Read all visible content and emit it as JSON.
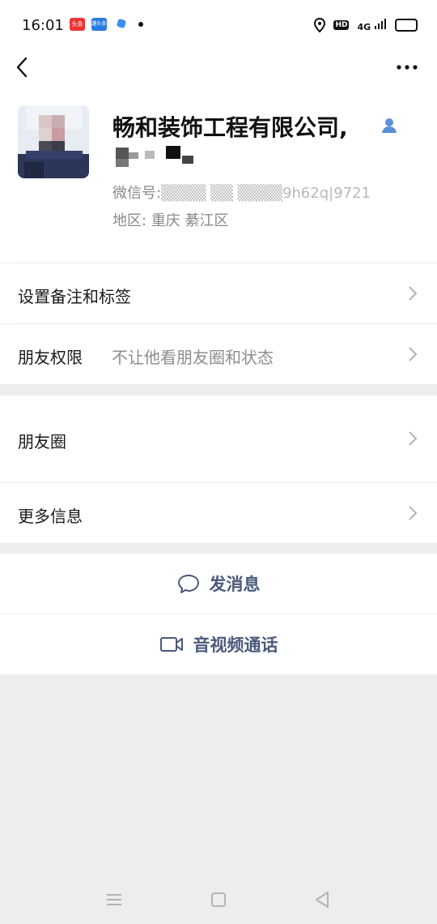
{
  "status_bar": {
    "time": "16:01",
    "app_badge_1": "头条",
    "app_badge_2": "趣头条",
    "network": "4G",
    "hd": "HD"
  },
  "profile": {
    "name": "畅和装饰工程有限公司,",
    "wechat_id_label": "微信号:",
    "wechat_id_value": "▒▒▒▒ ▒▒ ▒▒▒▒9h62q|9721",
    "region_label": "地区:",
    "region_value": "重庆  綦江区"
  },
  "rows": {
    "remark": {
      "label": "设置备注和标签"
    },
    "permission": {
      "label": "朋友权限",
      "value": "不让他看朋友圈和状态"
    },
    "moments": {
      "label": "朋友圈"
    },
    "more_info": {
      "label": "更多信息"
    }
  },
  "actions": {
    "message": "发消息",
    "call": "音视频通话"
  },
  "colors": {
    "action_text": "#4a5a7a",
    "accent_blue": "#5b8fd6",
    "background": "#ededed"
  }
}
